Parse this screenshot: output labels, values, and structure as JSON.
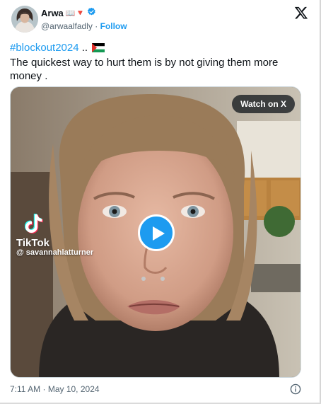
{
  "author": {
    "name": "Arwa",
    "name_emoji": "📖🔻",
    "handle": "@arwaalfadly",
    "separator": "·",
    "follow_label": "Follow"
  },
  "tweet": {
    "hashtag": "#blockout2024",
    "hashtag_suffix": " ..",
    "body": "The quickest way to hurt them is by not giving them more money ."
  },
  "media": {
    "watch_label": "Watch on X",
    "tiktok_brand": "TikTok",
    "tiktok_user": "@ savannahlatturner"
  },
  "meta": {
    "time": "7:11 AM",
    "separator": "·",
    "date": "May 10, 2024"
  },
  "colors": {
    "accent": "#1d9bf0",
    "text": "#0f1419",
    "muted": "#536471"
  }
}
